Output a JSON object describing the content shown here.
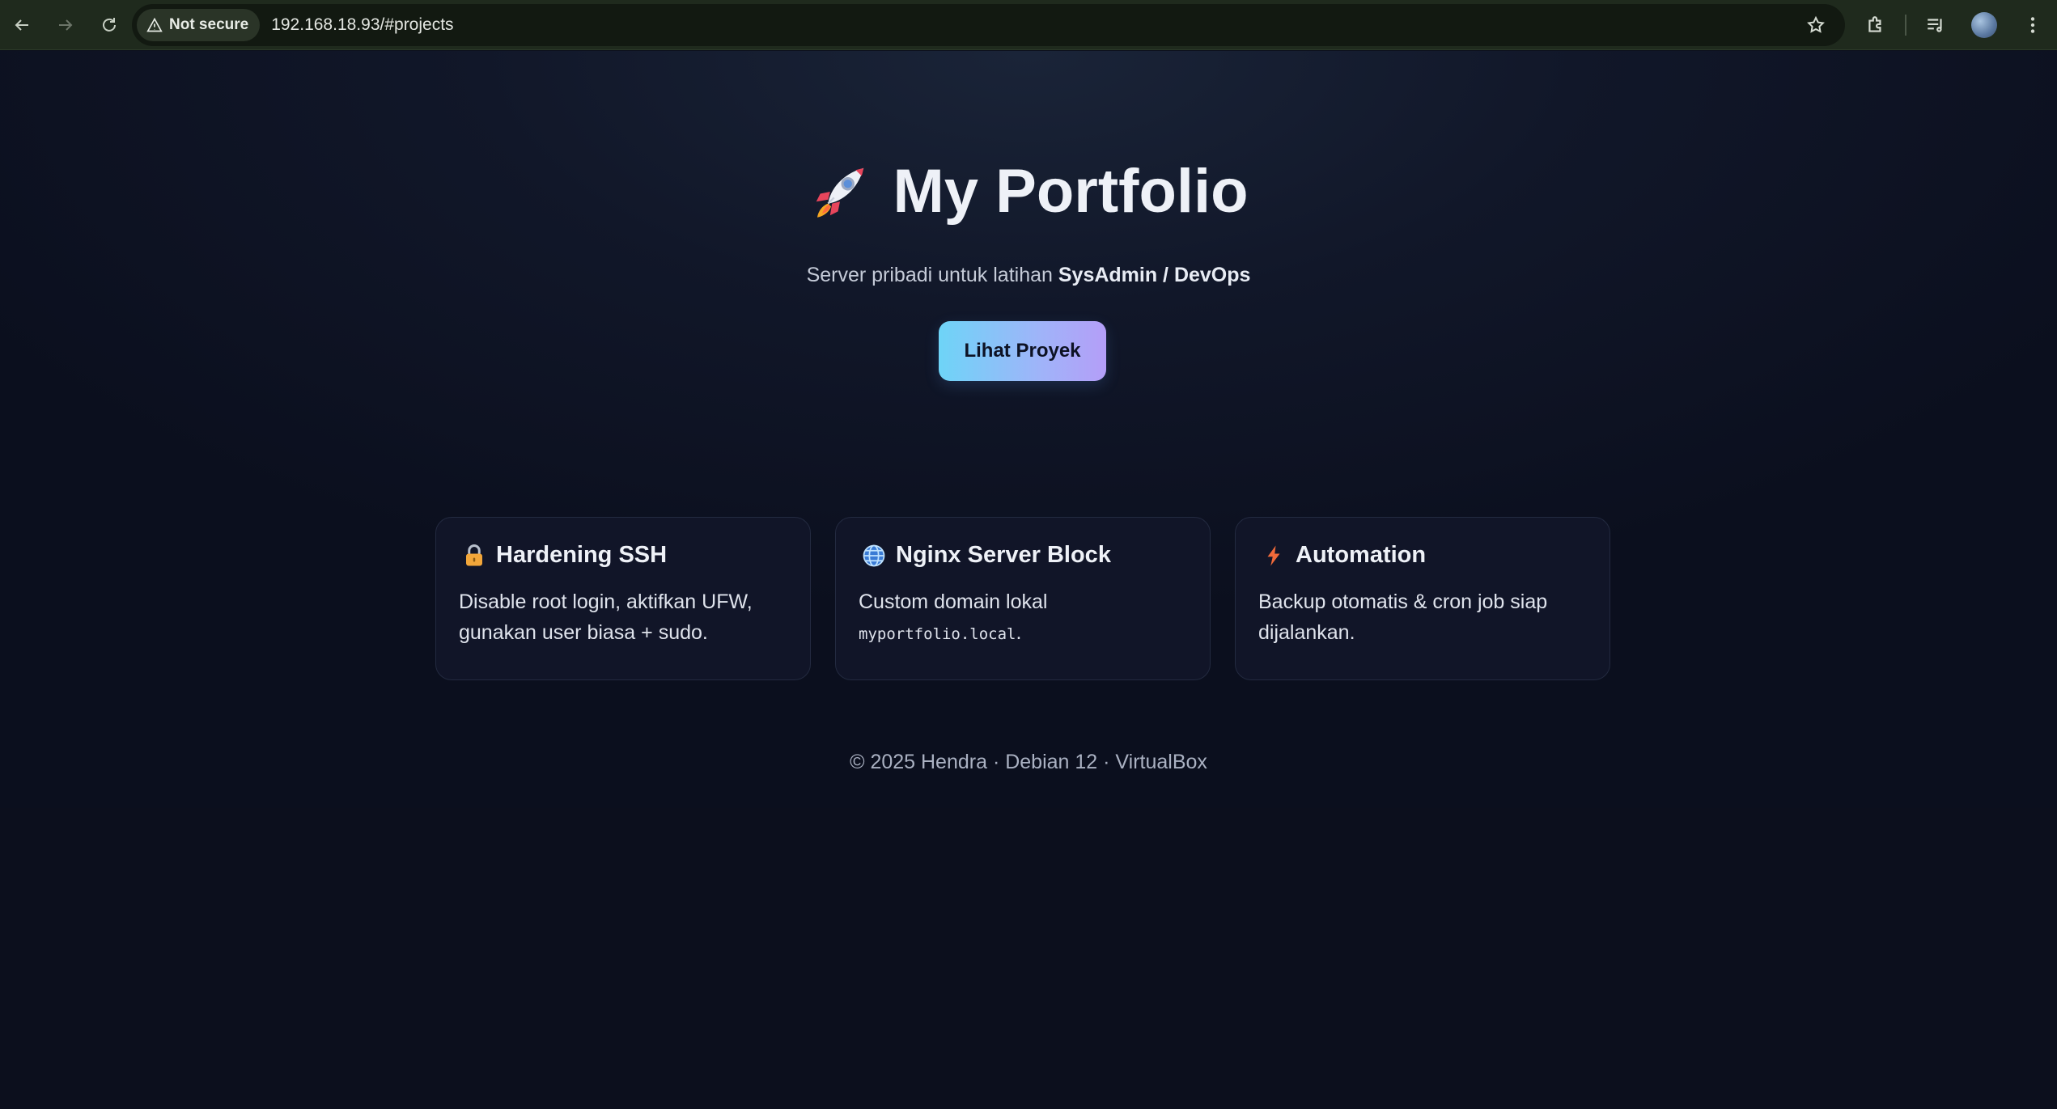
{
  "browser": {
    "back_icon": "arrow-left-icon",
    "forward_icon": "arrow-right-icon",
    "reload_icon": "reload-icon",
    "security_label": "Not secure",
    "url": "192.168.18.93/#projects"
  },
  "hero": {
    "title": "My Portfolio",
    "subtitle_prefix": "Server pribadi untuk latihan ",
    "subtitle_strong": "SysAdmin / DevOps",
    "cta_label": "Lihat Proyek"
  },
  "cards": [
    {
      "icon": "lock-icon",
      "title": "Hardening SSH",
      "desc_line1": "Disable root login, aktifkan UFW,",
      "desc_line2": "gunakan user biasa + sudo."
    },
    {
      "icon": "globe-icon",
      "title": "Nginx Server Block",
      "desc_line1": "Custom domain lokal",
      "desc_code": "myportfolio.local",
      "desc_code_suffix": "."
    },
    {
      "icon": "lightning-icon",
      "title": "Automation",
      "desc_line1": "Backup otomatis & cron job siap",
      "desc_line2": "dijalankan."
    }
  ],
  "footer": {
    "text": "© 2025 Hendra · Debian 12 · VirtualBox"
  },
  "colors": {
    "page_bg": "#0c0f1d",
    "card_bg": "#111528",
    "cta_gradient_start": "#6ed4f7",
    "cta_gradient_end": "#b49ef8"
  }
}
